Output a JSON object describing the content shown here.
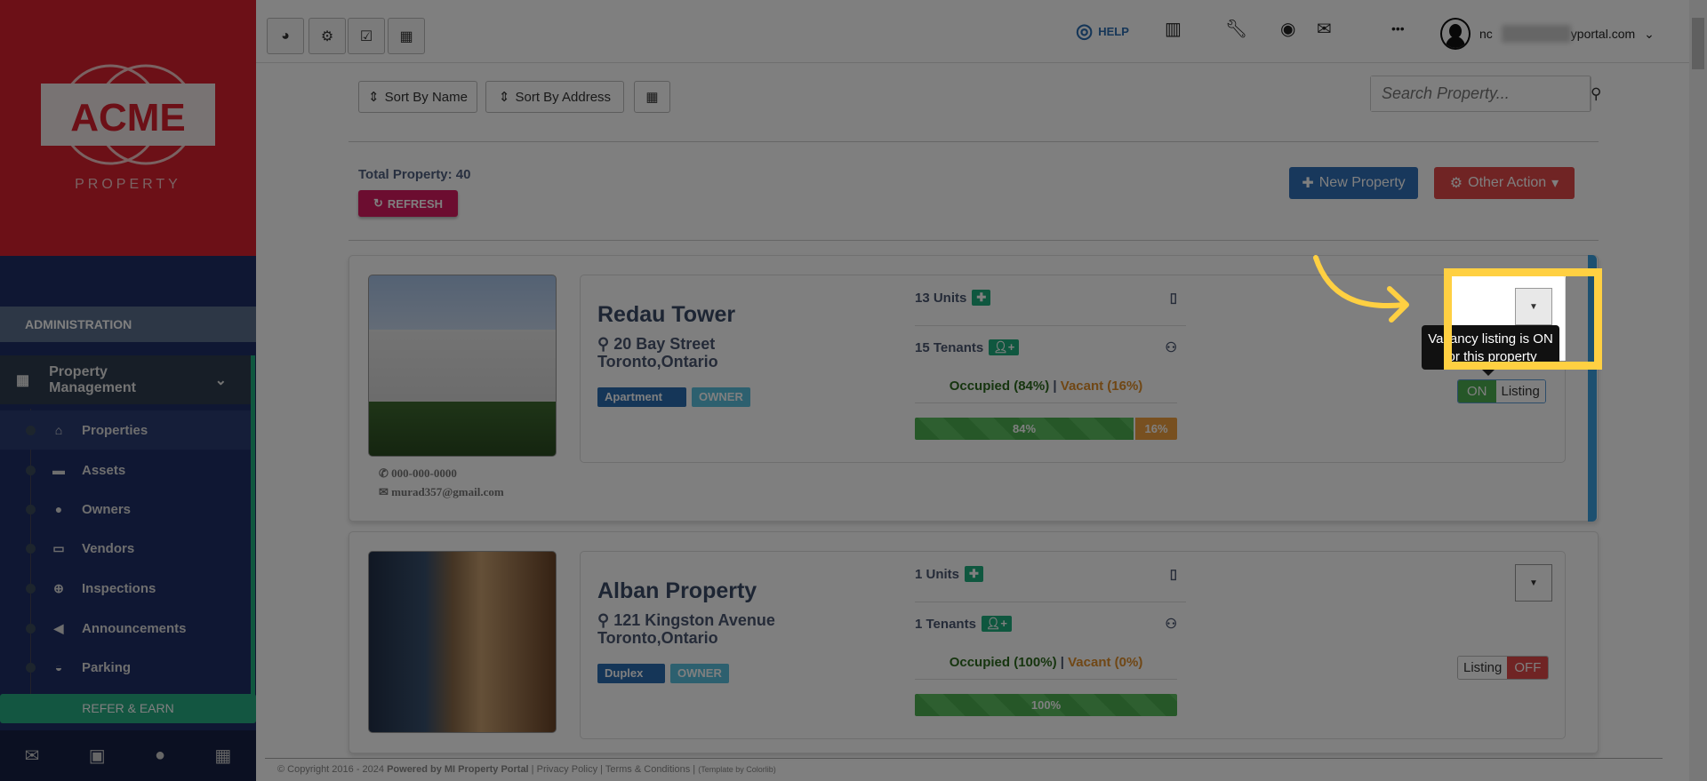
{
  "brand": {
    "logo_text": "ACME",
    "logo_sub": "PROPERTY",
    "primary": "#d8202e",
    "nav": "#1e2e66"
  },
  "sidebar": {
    "section": "ADMINISTRATION",
    "group": "Property Management",
    "items": [
      {
        "label": "Properties",
        "icon": "home-icon",
        "glyph": "⌂"
      },
      {
        "label": "Assets",
        "icon": "archive-icon",
        "glyph": "▬"
      },
      {
        "label": "Owners",
        "icon": "user-icon",
        "glyph": "●"
      },
      {
        "label": "Vendors",
        "icon": "briefcase-icon",
        "glyph": "▭"
      },
      {
        "label": "Inspections",
        "icon": "zoom-in-icon",
        "glyph": "⊕"
      },
      {
        "label": "Announcements",
        "icon": "bullhorn-icon",
        "glyph": "◀"
      },
      {
        "label": "Parking",
        "icon": "car-icon",
        "glyph": "◒"
      }
    ],
    "refer": "REFER & EARN"
  },
  "topbar": {
    "help": "HELP",
    "user_email_suffix": "yportal.com",
    "user_email_prefix": "nc"
  },
  "toolbar": {
    "sort_name": "Sort By Name",
    "sort_address": "Sort By Address",
    "search_placeholder": "Search Property...",
    "total": "Total Property: 40",
    "refresh": "REFRESH",
    "new_property": "New Property",
    "other_action": "Other Action"
  },
  "properties": [
    {
      "name": "Redau Tower",
      "street": "20 Bay Street",
      "city": "Toronto,Ontario",
      "type": "Apartment",
      "role": "OWNER",
      "units": "13 Units",
      "tenants": "15 Tenants",
      "occupied": "Occupied (84%)",
      "vacant": "Vacant (16%)",
      "occupied_pct": 84,
      "vacant_pct": 16,
      "occupied_label": "84%",
      "vacant_label": "16%",
      "phone": "000-000-0000",
      "email": "murad357@gmail.com",
      "listing_state": "ON",
      "listing_label": "Listing"
    },
    {
      "name": "Alban Property",
      "street": "121 Kingston Avenue",
      "city": "Toronto,Ontario",
      "type": "Duplex",
      "role": "OWNER",
      "units": "1 Units",
      "tenants": "1 Tenants",
      "occupied": "Occupied (100%)",
      "vacant": "Vacant (0%)",
      "occupied_pct": 100,
      "vacant_pct": 0,
      "occupied_label": "100%",
      "listing_state": "OFF",
      "listing_label": "Listing"
    }
  ],
  "tooltip": "Vacancy listing is ON for this property",
  "footer": {
    "copyright": "© Copyright 2016 - 2024",
    "powered": "Powered by MI Property Portal",
    "privacy": "Privacy Policy",
    "terms": "Terms & Conditions",
    "template": "(Template by Colorlib)"
  }
}
